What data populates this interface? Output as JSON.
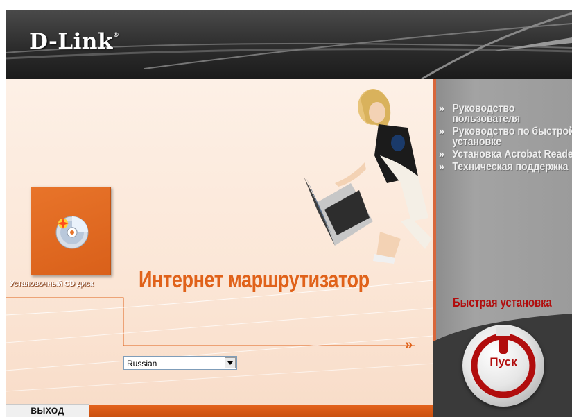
{
  "brand": {
    "logo": "D-Link",
    "trademark": "®"
  },
  "main": {
    "cd_label": "Установочный CD диск",
    "product_title": "Интернет маршрутизатор",
    "arrow": "»"
  },
  "language_select": {
    "selected": "Russian"
  },
  "exit_button": {
    "label": "ВЫХОД"
  },
  "menu": {
    "items": [
      {
        "bullet": "»",
        "label": "Руководство пользователя"
      },
      {
        "bullet": "»",
        "label": "Руководство по быстрой установке"
      },
      {
        "bullet": "»",
        "label": "Установка Acrobat Reader"
      },
      {
        "bullet": "»",
        "label": "Техническая поддержка"
      }
    ]
  },
  "quick_install": {
    "title": "Быстрая установка",
    "start_label": "Пуск"
  },
  "colors": {
    "accent": "#e0621a",
    "quick_red": "#b10d0d",
    "panel_grey": "#9b9b9b"
  }
}
